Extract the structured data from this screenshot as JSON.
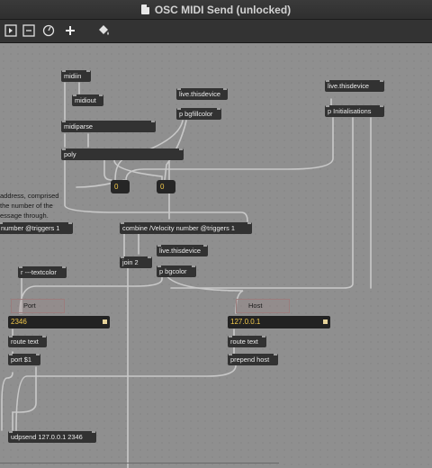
{
  "window": {
    "title": "OSC MIDI Send (unlocked)"
  },
  "toolbar": {
    "icons": [
      "presentation-icon",
      "minimize-icon",
      "dial-icon",
      "add-icon",
      "paint-bucket-icon"
    ]
  },
  "objects": {
    "midiin": "midiin",
    "midiout": "midiout",
    "midiparse": "midiparse",
    "poly": "poly",
    "live_thisdevice_1": "live.thisdevice",
    "p_bgfillcolor": "p bgfillcolor",
    "live_thisdevice_2": "live.thisdevice",
    "p_initialisations": "p Initialisations",
    "number_triggers": "number @triggers 1",
    "combine": "combine /Velocity number @triggers 1",
    "live_thisdevice_3": "live.thisdevice",
    "join": "join 2",
    "p_bgcolor": "p bgcolor",
    "r_textcolor": "r ---textcolor",
    "route_text_1": "route text",
    "port": "port $1",
    "route_text_2": "route text",
    "prepend_host": "prepend host",
    "udpsend": "udpsend 127.0.0.1 2346"
  },
  "number_boxes": {
    "left": "0",
    "right": "0"
  },
  "text_fields": {
    "port": "2346",
    "host": "127.0.0.1"
  },
  "labels": {
    "port": "Port",
    "host": "Host"
  },
  "comment_lines": [
    "address, comprised",
    "the number of the",
    "essage through."
  ],
  "colors": {
    "canvas": "#8f8f8f",
    "object": "#323232",
    "patch_cord": "#c9c9c9",
    "number_text": "#f2c94c"
  }
}
